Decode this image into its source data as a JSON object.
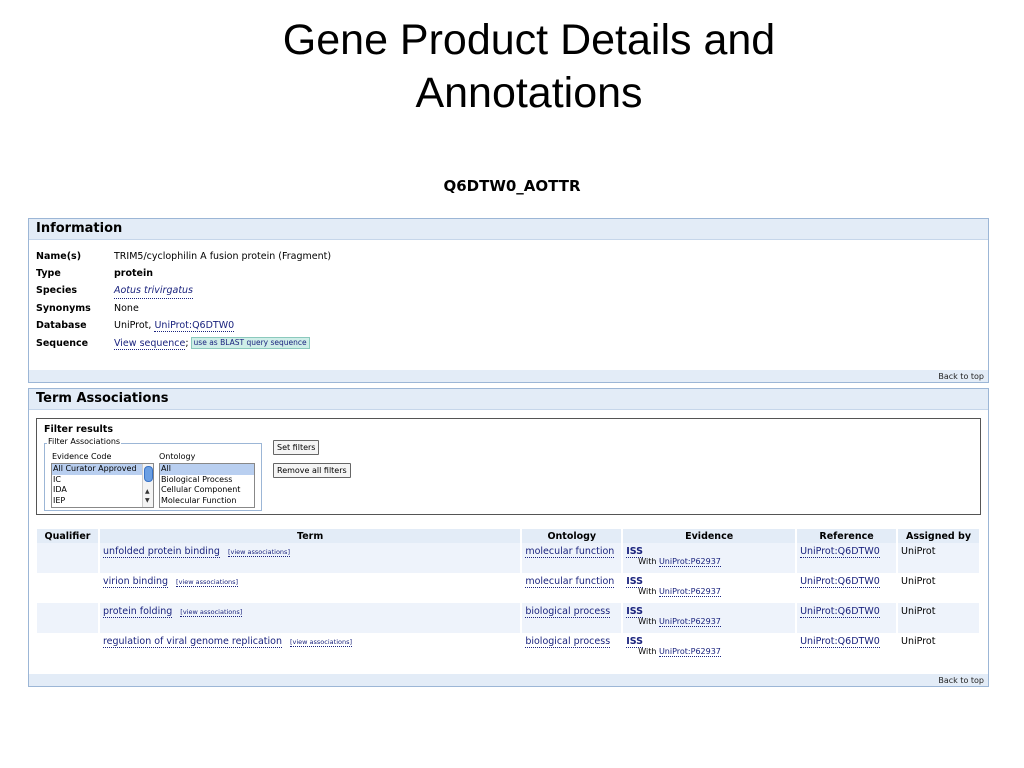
{
  "slide": {
    "title_line1": "Gene Product Details and",
    "title_line2": "Annotations"
  },
  "gene_product_id": "Q6DTW0_AOTTR",
  "information": {
    "heading": "Information",
    "rows": [
      {
        "key": "Name(s)",
        "value": "TRIM5/cyclophilin A fusion protein (Fragment)"
      },
      {
        "key": "Type",
        "value": "protein"
      },
      {
        "key": "Species",
        "value": "Aotus trivirgatus"
      },
      {
        "key": "Synonyms",
        "value": "None"
      },
      {
        "key": "Database",
        "value": "UniProt,",
        "link": "UniProt:Q6DTW0"
      },
      {
        "key": "Sequence",
        "value": "View sequence",
        "sep": ";",
        "button": "use as BLAST query sequence"
      }
    ],
    "back_to_top": "Back to top"
  },
  "term_associations": {
    "heading": "Term Associations",
    "filter": {
      "title": "Filter results",
      "legend": "Filter Associations",
      "evidence_label": "Evidence Code",
      "evidence_options": [
        "All Curator Approved",
        "IC",
        "IDA",
        "IEP"
      ],
      "ontology_label": "Ontology",
      "ontology_options": [
        "All",
        "Biological Process",
        "Cellular Component",
        "Molecular Function"
      ],
      "set_filters": "Set filters",
      "remove_filters": "Remove all filters"
    },
    "columns": [
      "Qualifier",
      "Term",
      "Ontology",
      "Evidence",
      "Reference",
      "Assigned by"
    ],
    "view_assoc_label": "[view associations]",
    "with_label": "With",
    "rows": [
      {
        "qualifier": "",
        "term": "unfolded protein binding",
        "ontology": "molecular function",
        "evidence": "ISS",
        "with": "UniProt:P62937",
        "reference": "UniProt:Q6DTW0",
        "assigned_by": "UniProt"
      },
      {
        "qualifier": "",
        "term": "virion binding",
        "ontology": "molecular function",
        "evidence": "ISS",
        "with": "UniProt:P62937",
        "reference": "UniProt:Q6DTW0",
        "assigned_by": "UniProt"
      },
      {
        "qualifier": "",
        "term": "protein folding",
        "ontology": "biological process",
        "evidence": "ISS",
        "with": "UniProt:P62937",
        "reference": "UniProt:Q6DTW0",
        "assigned_by": "UniProt"
      },
      {
        "qualifier": "",
        "term": "regulation of viral genome replication",
        "ontology": "biological process",
        "evidence": "ISS",
        "with": "UniProt:P62937",
        "reference": "UniProt:Q6DTW0",
        "assigned_by": "UniProt"
      }
    ],
    "back_to_top": "Back to top"
  }
}
